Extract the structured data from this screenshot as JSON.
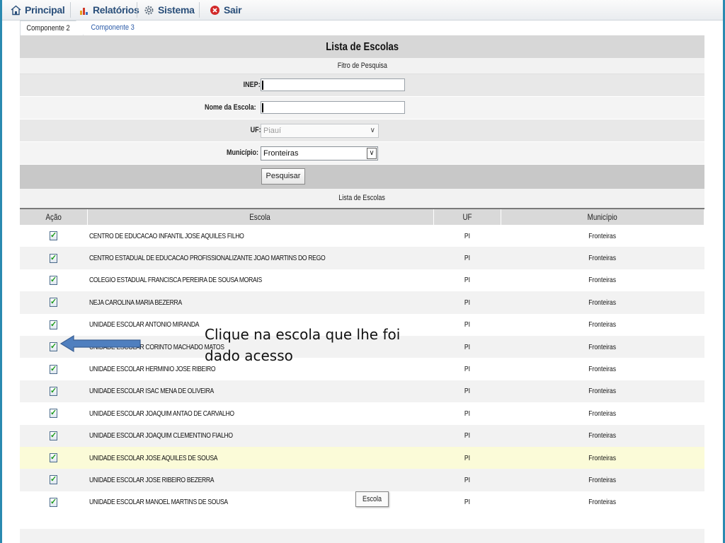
{
  "menu": {
    "items": [
      {
        "label": "Principal",
        "icon": "home-icon"
      },
      {
        "label": "Relatórios",
        "icon": "chart-icon"
      },
      {
        "label": "Sistema",
        "icon": "gear-icon"
      },
      {
        "label": "Sair",
        "icon": "close-circle-icon"
      }
    ]
  },
  "tabs": [
    {
      "label": "Componente 2",
      "active": true
    },
    {
      "label": "Componente 3",
      "active": false
    }
  ],
  "panel": {
    "title": "Lista de Escolas",
    "filter_title": "Fitro de Pesquisa",
    "fields": {
      "inep_label": "INEP:",
      "inep_value": "",
      "nome_label": "Nome da Escola:",
      "nome_value": "",
      "uf_label": "UF:",
      "uf_value": "Piauí",
      "municipio_label": "Município:",
      "municipio_value": "Fronteiras"
    },
    "search_button": "Pesquisar",
    "list_title": "Lista de Escolas"
  },
  "table": {
    "headers": [
      "Ação",
      "Escola",
      "UF",
      "Município"
    ],
    "rows": [
      {
        "escola": "CENTRO DE EDUCACAO INFANTIL JOSE AQUILES FILHO",
        "uf": "PI",
        "municipio": "Fronteiras"
      },
      {
        "escola": "CENTRO ESTADUAL DE EDUCACAO PROFISSIONALIZANTE JOAO MARTINS DO REGO",
        "uf": "PI",
        "municipio": "Fronteiras"
      },
      {
        "escola": "COLEGIO ESTADUAL FRANCISCA PEREIRA DE SOUSA MORAIS",
        "uf": "PI",
        "municipio": "Fronteiras"
      },
      {
        "escola": "NEJA CAROLINA MARIA BEZERRA",
        "uf": "PI",
        "municipio": "Fronteiras"
      },
      {
        "escola": "UNIDADE ESCOLAR ANTONIO MIRANDA",
        "uf": "PI",
        "municipio": "Fronteiras"
      },
      {
        "escola": "UNIDADE ESCOLAR CORINTO MACHADO MATOS",
        "uf": "PI",
        "municipio": "Fronteiras"
      },
      {
        "escola": "UNIDADE ESCOLAR HERMINIO JOSE RIBEIRO",
        "uf": "PI",
        "municipio": "Fronteiras"
      },
      {
        "escola": "UNIDADE ESCOLAR ISAC MENA DE OLIVEIRA",
        "uf": "PI",
        "municipio": "Fronteiras"
      },
      {
        "escola": "UNIDADE ESCOLAR JOAQUIM ANTAO DE CARVALHO",
        "uf": "PI",
        "municipio": "Fronteiras"
      },
      {
        "escola": "UNIDADE ESCOLAR JOAQUIM CLEMENTINO FIALHO",
        "uf": "PI",
        "municipio": "Fronteiras"
      },
      {
        "escola": "UNIDADE ESCOLAR JOSE AQUILES DE SOUSA",
        "uf": "PI",
        "municipio": "Fronteiras",
        "highlighted": true
      },
      {
        "escola": "UNIDADE ESCOLAR JOSE RIBEIRO BEZERRA",
        "uf": "PI",
        "municipio": "Fronteiras"
      },
      {
        "escola": "UNIDADE ESCOLAR MANOEL MARTINS DE SOUSA",
        "uf": "PI",
        "municipio": "Fronteiras"
      }
    ]
  },
  "annotation": {
    "text": "Clique na escola que lhe foi dado acesso"
  },
  "tooltip": "Escola",
  "colors": {
    "menu_text": "#2a4f7a",
    "highlight_row": "#fbfbd8",
    "arrow": "#4f7fbf"
  }
}
